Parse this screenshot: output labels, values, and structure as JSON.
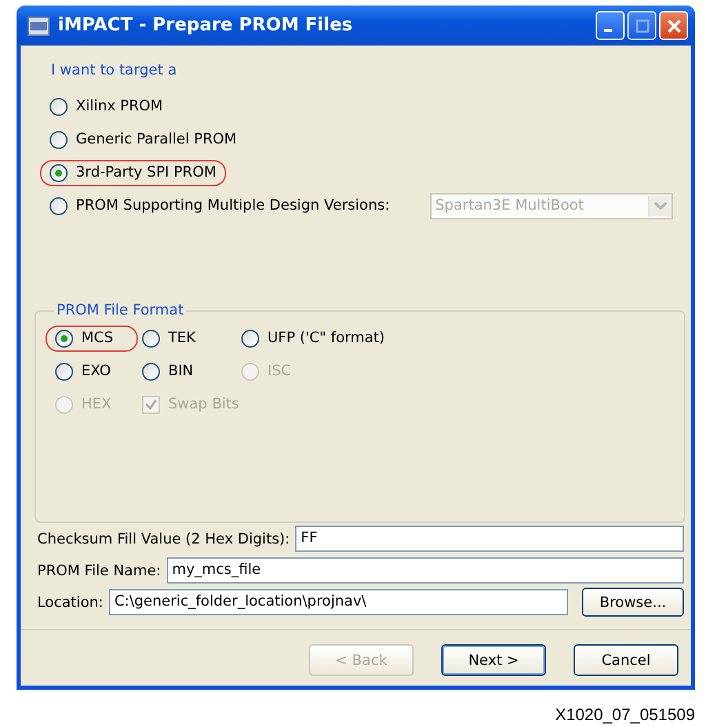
{
  "window": {
    "title": "iMPACT - Prepare PROM Files"
  },
  "target": {
    "heading": "I want to target a",
    "options": [
      {
        "label": "Xilinx PROM",
        "selected": false,
        "highlighted": false
      },
      {
        "label": "Generic Parallel PROM",
        "selected": false,
        "highlighted": false
      },
      {
        "label": "3rd-Party SPI PROM",
        "selected": true,
        "highlighted": true
      },
      {
        "label": "PROM Supporting Multiple Design Versions:",
        "selected": false,
        "highlighted": false
      }
    ],
    "dropdown": {
      "value": "Spartan3E MultiBoot",
      "disabled": true
    }
  },
  "format": {
    "heading": "PROM File Format",
    "rows": [
      [
        {
          "kind": "radio",
          "label": "MCS",
          "selected": true,
          "disabled": false,
          "highlighted": true
        },
        {
          "kind": "radio",
          "label": "TEK",
          "selected": false,
          "disabled": false,
          "highlighted": false
        },
        {
          "kind": "radio",
          "label": "UFP ('C\" format)",
          "selected": false,
          "disabled": false,
          "highlighted": false
        }
      ],
      [
        {
          "kind": "radio",
          "label": "EXO",
          "selected": false,
          "disabled": false,
          "highlighted": false
        },
        {
          "kind": "radio",
          "label": "BIN",
          "selected": false,
          "disabled": false,
          "highlighted": false
        },
        {
          "kind": "radio",
          "label": "ISC",
          "selected": false,
          "disabled": true,
          "highlighted": false
        }
      ],
      [
        {
          "kind": "radio",
          "label": "HEX",
          "selected": false,
          "disabled": true,
          "highlighted": false
        },
        {
          "kind": "checkbox",
          "label": "Swap Bits",
          "checked": true,
          "disabled": true
        }
      ]
    ]
  },
  "fields": [
    {
      "label": "Checksum Fill Value (2 Hex Digits):",
      "value": "FF"
    },
    {
      "label": "PROM File Name:",
      "value": "my_mcs_file"
    },
    {
      "label": "Location:",
      "value": "C:\\generic_folder_location\\projnav\\",
      "button": "Browse..."
    }
  ],
  "buttons": [
    {
      "label": "< Back",
      "disabled": true,
      "default": false
    },
    {
      "label": "Next >",
      "disabled": false,
      "default": true
    },
    {
      "label": "Cancel",
      "disabled": false,
      "default": false
    }
  ],
  "figure_id": "X1020_07_051509"
}
